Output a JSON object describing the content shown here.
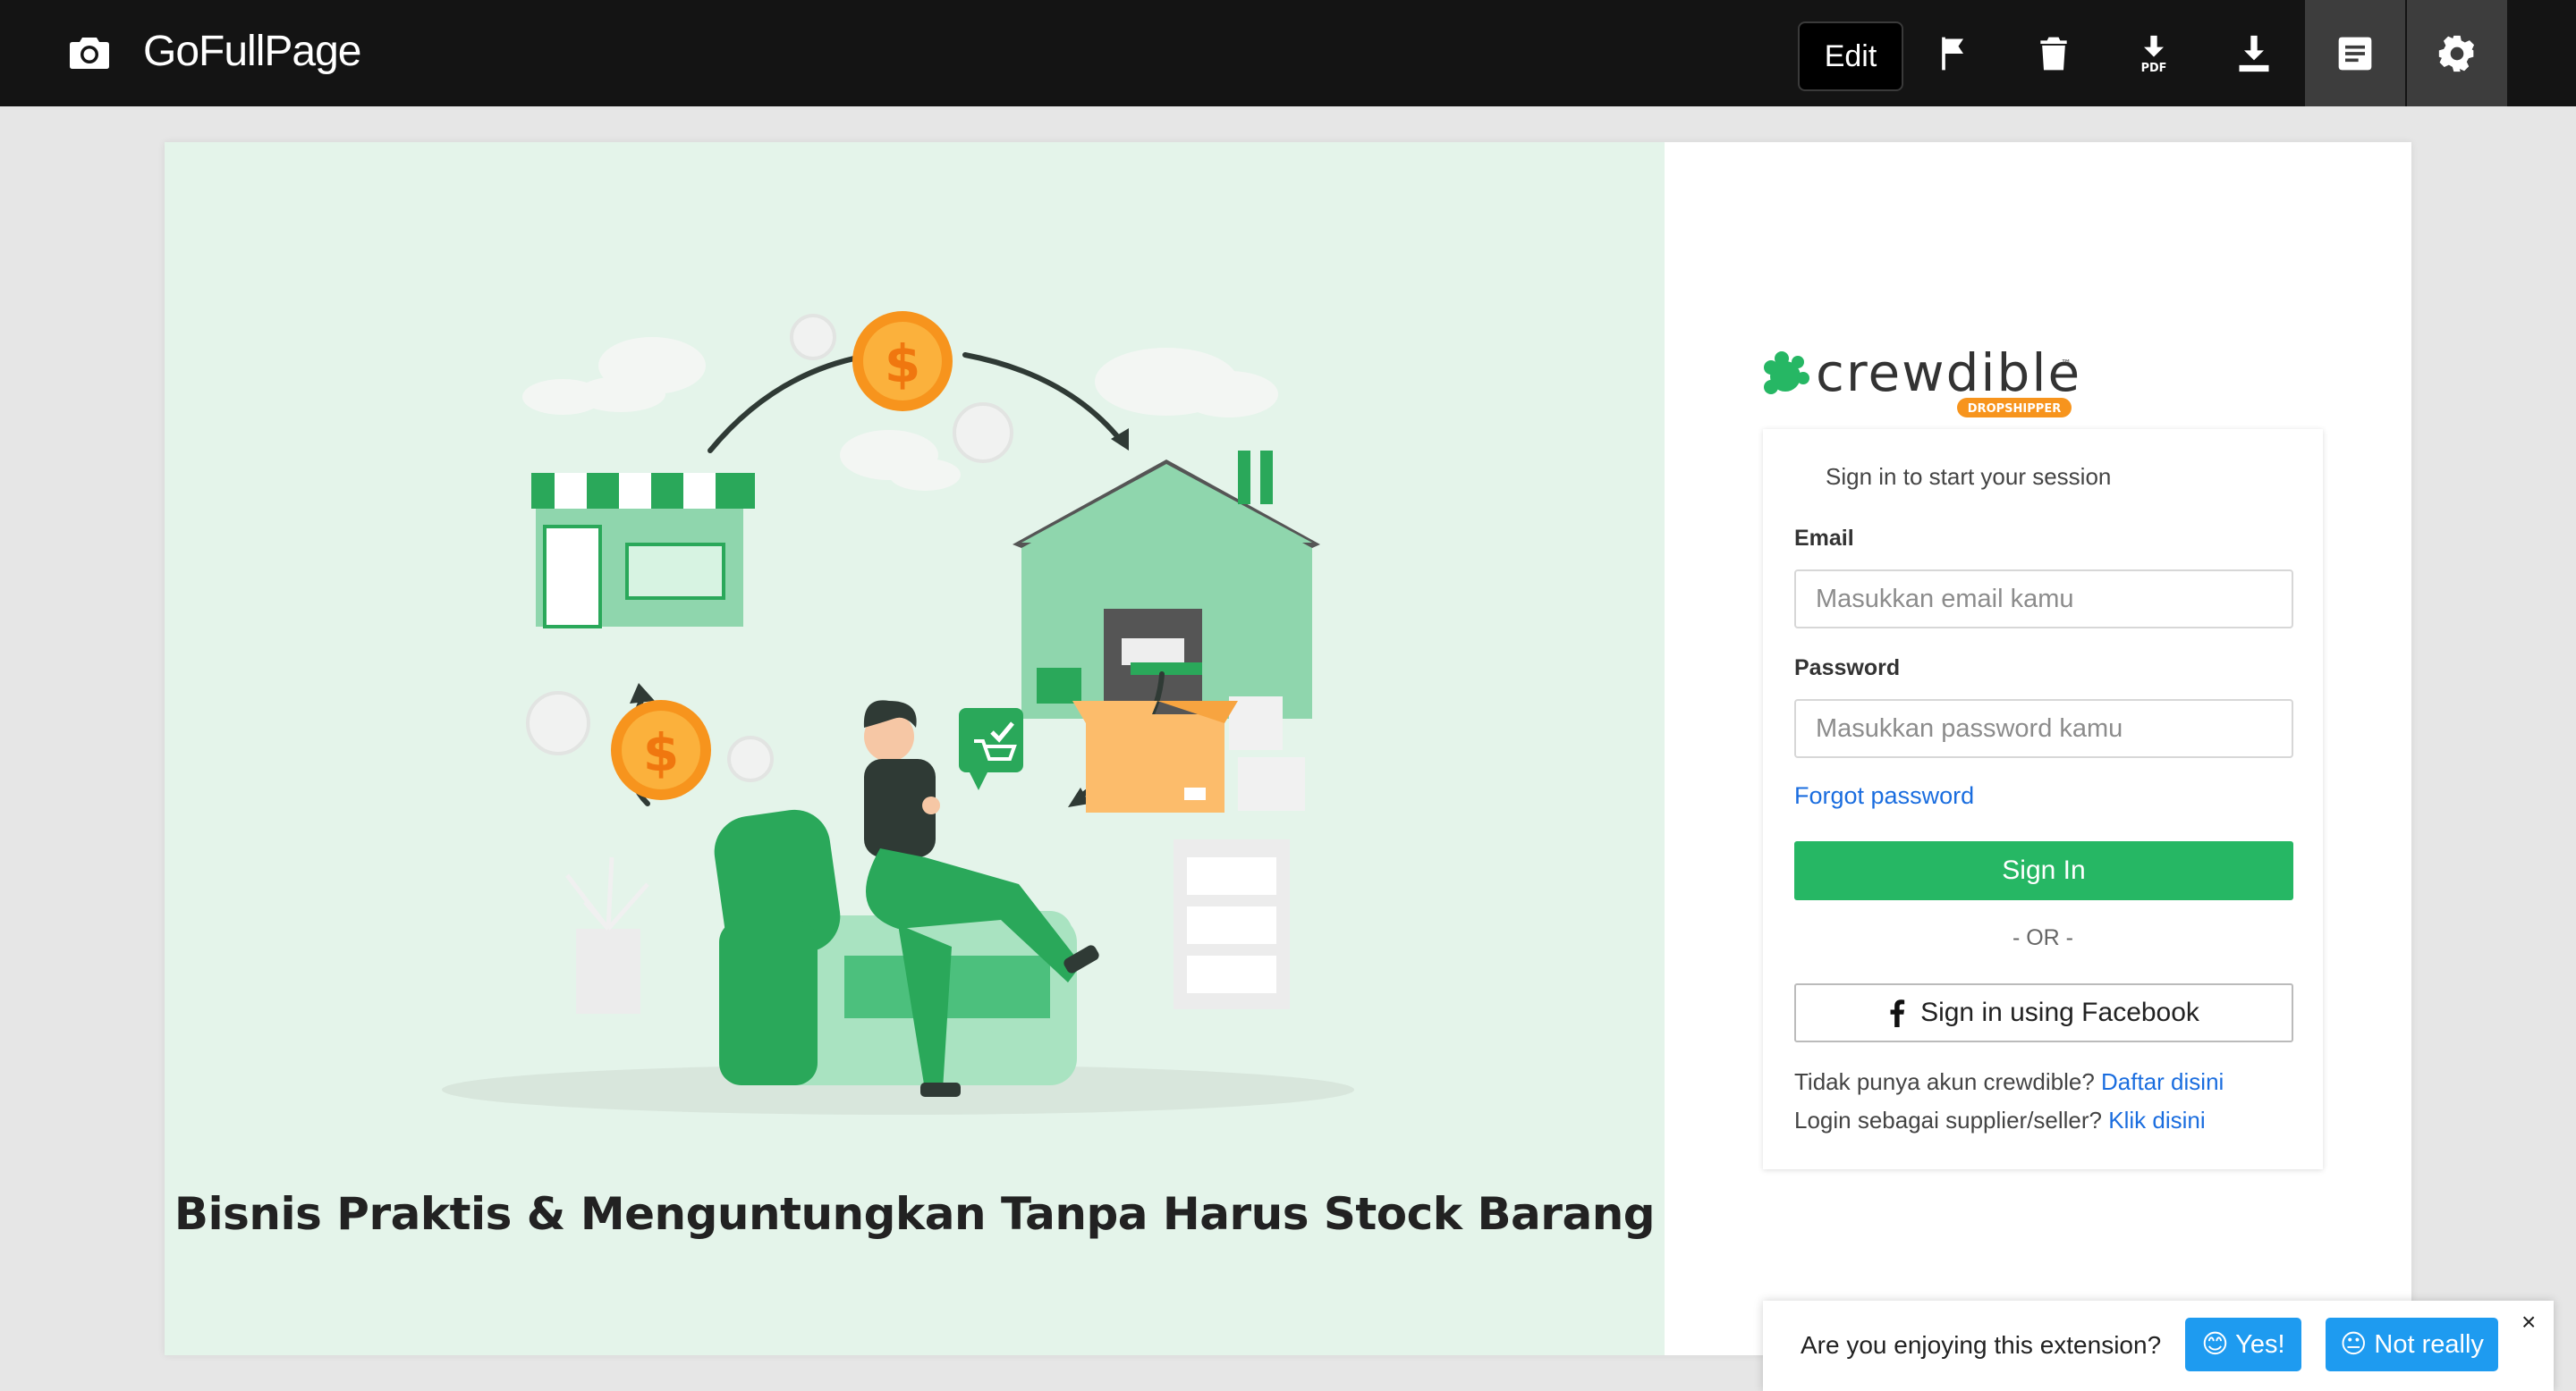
{
  "toolbar": {
    "app_title": "GoFullPage",
    "edit_label": "Edit",
    "icons": [
      "camera-icon",
      "flag-icon",
      "trash-icon",
      "download-pdf-icon",
      "download-icon",
      "notes-icon",
      "gear-icon"
    ],
    "pdf_text": "PDF"
  },
  "hero": {
    "caption": "Bisnis Praktis & Menguntungkan Tanpa Harus Stock Barang",
    "background": "#e4f4ea"
  },
  "brand": {
    "name": "crewdible",
    "tm": "™",
    "badge": "DROPSHIPPER",
    "green": "#26b764",
    "orange": "#f7941d"
  },
  "login": {
    "message": "Sign in to start your session",
    "email_label": "Email",
    "email_placeholder": "Masukkan email kamu",
    "password_label": "Password",
    "password_placeholder": "Masukkan password kamu",
    "forgot": "Forgot password",
    "signin": "Sign In",
    "or": "- OR -",
    "facebook": "Sign in using Facebook",
    "register_prompt": "Tidak punya akun crewdible?",
    "register_link": "Daftar disini",
    "supplier_prompt": "Login sebagai supplier/seller?",
    "supplier_link": "Klik disini"
  },
  "feedback": {
    "question": "Are you enjoying this extension?",
    "yes": "😊 Yes!",
    "no": "😐 Not really",
    "close": "×"
  }
}
